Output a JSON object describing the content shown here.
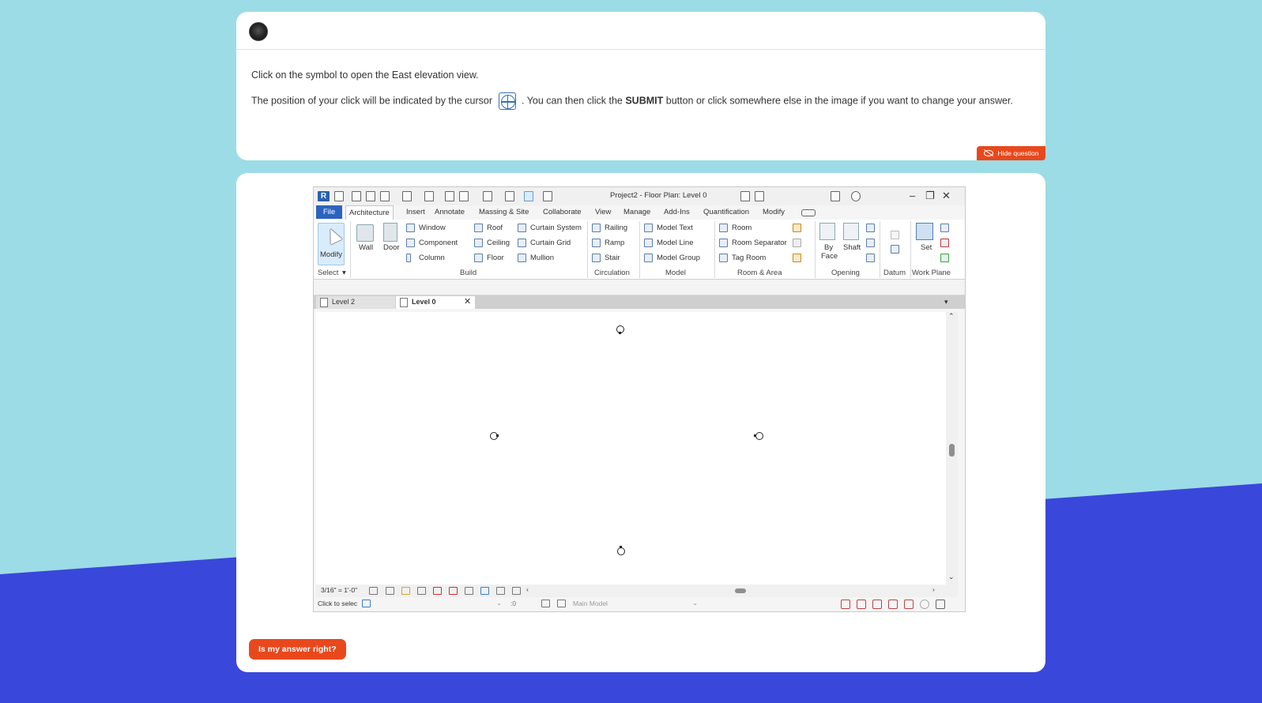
{
  "question": {
    "instruction": "Click on the symbol to open the East elevation view.",
    "cursor_text_before": "The position of your click will be indicated by the cursor",
    "cursor_text_after": ". You can then click the",
    "submit_word": "SUBMIT",
    "cursor_text_end": "button or click somewhere else in the image if you want to change your answer.",
    "hide_label": "Hide question"
  },
  "submit_button": "Is my answer right?",
  "revit": {
    "title": "Project2 - Floor Plan: Level 0",
    "menu": [
      "File",
      "Architecture",
      "Insert",
      "Annotate",
      "Massing & Site",
      "Collaborate",
      "View",
      "Manage",
      "Add-Ins",
      "Quantification",
      "Modify"
    ],
    "active_tab": "Architecture",
    "ribbon": {
      "modify": "Modify",
      "wall": "Wall",
      "door": "Door",
      "window": "Window",
      "component": "Component",
      "column": "Column",
      "roof": "Roof",
      "ceiling": "Ceiling",
      "floor": "Floor",
      "curtain_system": "Curtain System",
      "curtain_grid": "Curtain Grid",
      "mullion": "Mullion",
      "railing": "Railing",
      "ramp": "Ramp",
      "stair": "Stair",
      "model_text": "Model Text",
      "model_line": "Model Line",
      "model_group": "Model Group",
      "room": "Room",
      "room_separator": "Room Separator",
      "tag_room": "Tag Room",
      "by_face_1": "By",
      "by_face_2": "Face",
      "shaft": "Shaft",
      "set": "Set"
    },
    "panels": {
      "select": "Select",
      "build": "Build",
      "circulation": "Circulation",
      "model": "Model",
      "room_area": "Room & Area",
      "opening": "Opening",
      "datum": "Datum",
      "work_plane": "Work Plane"
    },
    "tabs": [
      "Level 2",
      "Level 0"
    ],
    "active_view_tab": "Level 0",
    "scale": "3/16\" = 1'-0\"",
    "status_text": "Click to selec",
    "worksets_value": ":0",
    "main_model": "Main Model"
  }
}
